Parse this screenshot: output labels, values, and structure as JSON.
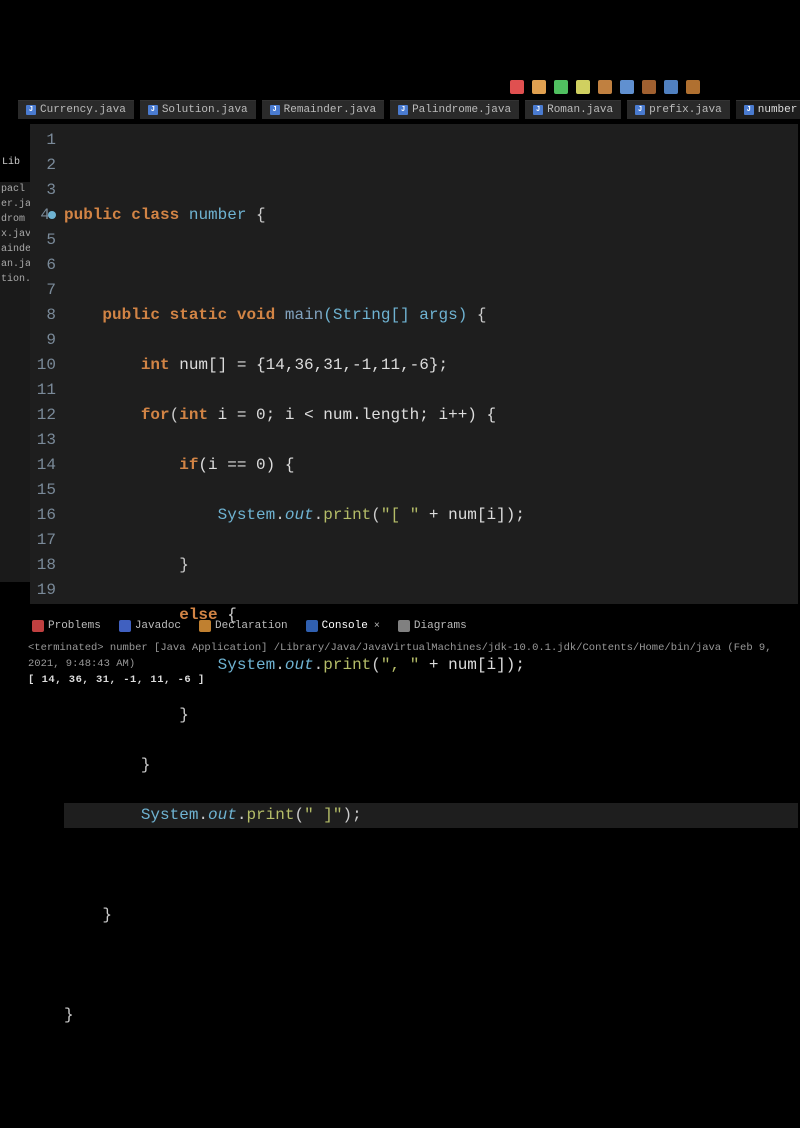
{
  "tabs": [
    {
      "label": "Currency.java"
    },
    {
      "label": "Solution.java"
    },
    {
      "label": "Remainder.java"
    },
    {
      "label": "Palindrome.java"
    },
    {
      "label": "Roman.java"
    },
    {
      "label": "prefix.java"
    },
    {
      "label": "number.java"
    }
  ],
  "sidebar": {
    "lib": "Lib",
    "items": [
      "pacl",
      "er.ja",
      "drom",
      "x.jav",
      "ainde",
      "an.ja",
      "tion.j"
    ]
  },
  "gutter": [
    "1",
    "2",
    "3",
    "4",
    "5",
    "6",
    "7",
    "8",
    "9",
    "10",
    "11",
    "12",
    "13",
    "14",
    "15",
    "16",
    "17",
    "18",
    "19"
  ],
  "code": {
    "l1": "",
    "l2_public": "public",
    "l2_class": "class",
    "l2_name": "number",
    "l2_brace": " {",
    "l3": "",
    "l4_public": "public",
    "l4_static": "static",
    "l4_void": "void",
    "l4_main": "main",
    "l4_params": "(String[] args)",
    "l4_brace": " {",
    "l5_int": "int",
    "l5_rest": " num[] = {14,36,31,-1,11,-6};",
    "l6_for": "for",
    "l6_open": "(",
    "l6_int": "int",
    "l6_rest": " i = 0; i < num.length; i++) {",
    "l7_if": "if",
    "l7_rest": "(i == 0) {",
    "l8_sys": "System",
    "l8_dot1": ".",
    "l8_out": "out",
    "l8_dot2": ".",
    "l8_print": "print",
    "l8_open": "(",
    "l8_str": "\"[ \"",
    "l8_plus": " + num[i]);",
    "l9": "}",
    "l10_else": "else",
    "l10_brace": " {",
    "l11_sys": "System",
    "l11_dot1": ".",
    "l11_out": "out",
    "l11_dot2": ".",
    "l11_print": "print",
    "l11_open": "(",
    "l11_str": "\", \"",
    "l11_plus": " + num[i]);",
    "l12": "}",
    "l13": "}",
    "l14_sys": "System",
    "l14_dot1": ".",
    "l14_out": "out",
    "l14_dot2": ".",
    "l14_print": "print",
    "l14_open": "(",
    "l14_str": "\" ]\"",
    "l14_end": ");",
    "l15": "",
    "l16": "}",
    "l17": "",
    "l18": "}",
    "l19": ""
  },
  "bottom_tabs": {
    "problems": "Problems",
    "javadoc": "Javadoc",
    "declaration": "Declaration",
    "console": "Console",
    "diagrams": "Diagrams"
  },
  "console": {
    "header": "<terminated> number [Java Application] /Library/Java/JavaVirtualMachines/jdk-10.0.1.jdk/Contents/Home/bin/java (Feb 9, 2021, 9:48:43 AM)",
    "output": "[ 14, 36, 31, -1, 11, -6 ]"
  },
  "toolbar_icons": [
    "run",
    "debug",
    "stop",
    "new",
    "save",
    "search",
    "pencil",
    "gear",
    "step"
  ]
}
